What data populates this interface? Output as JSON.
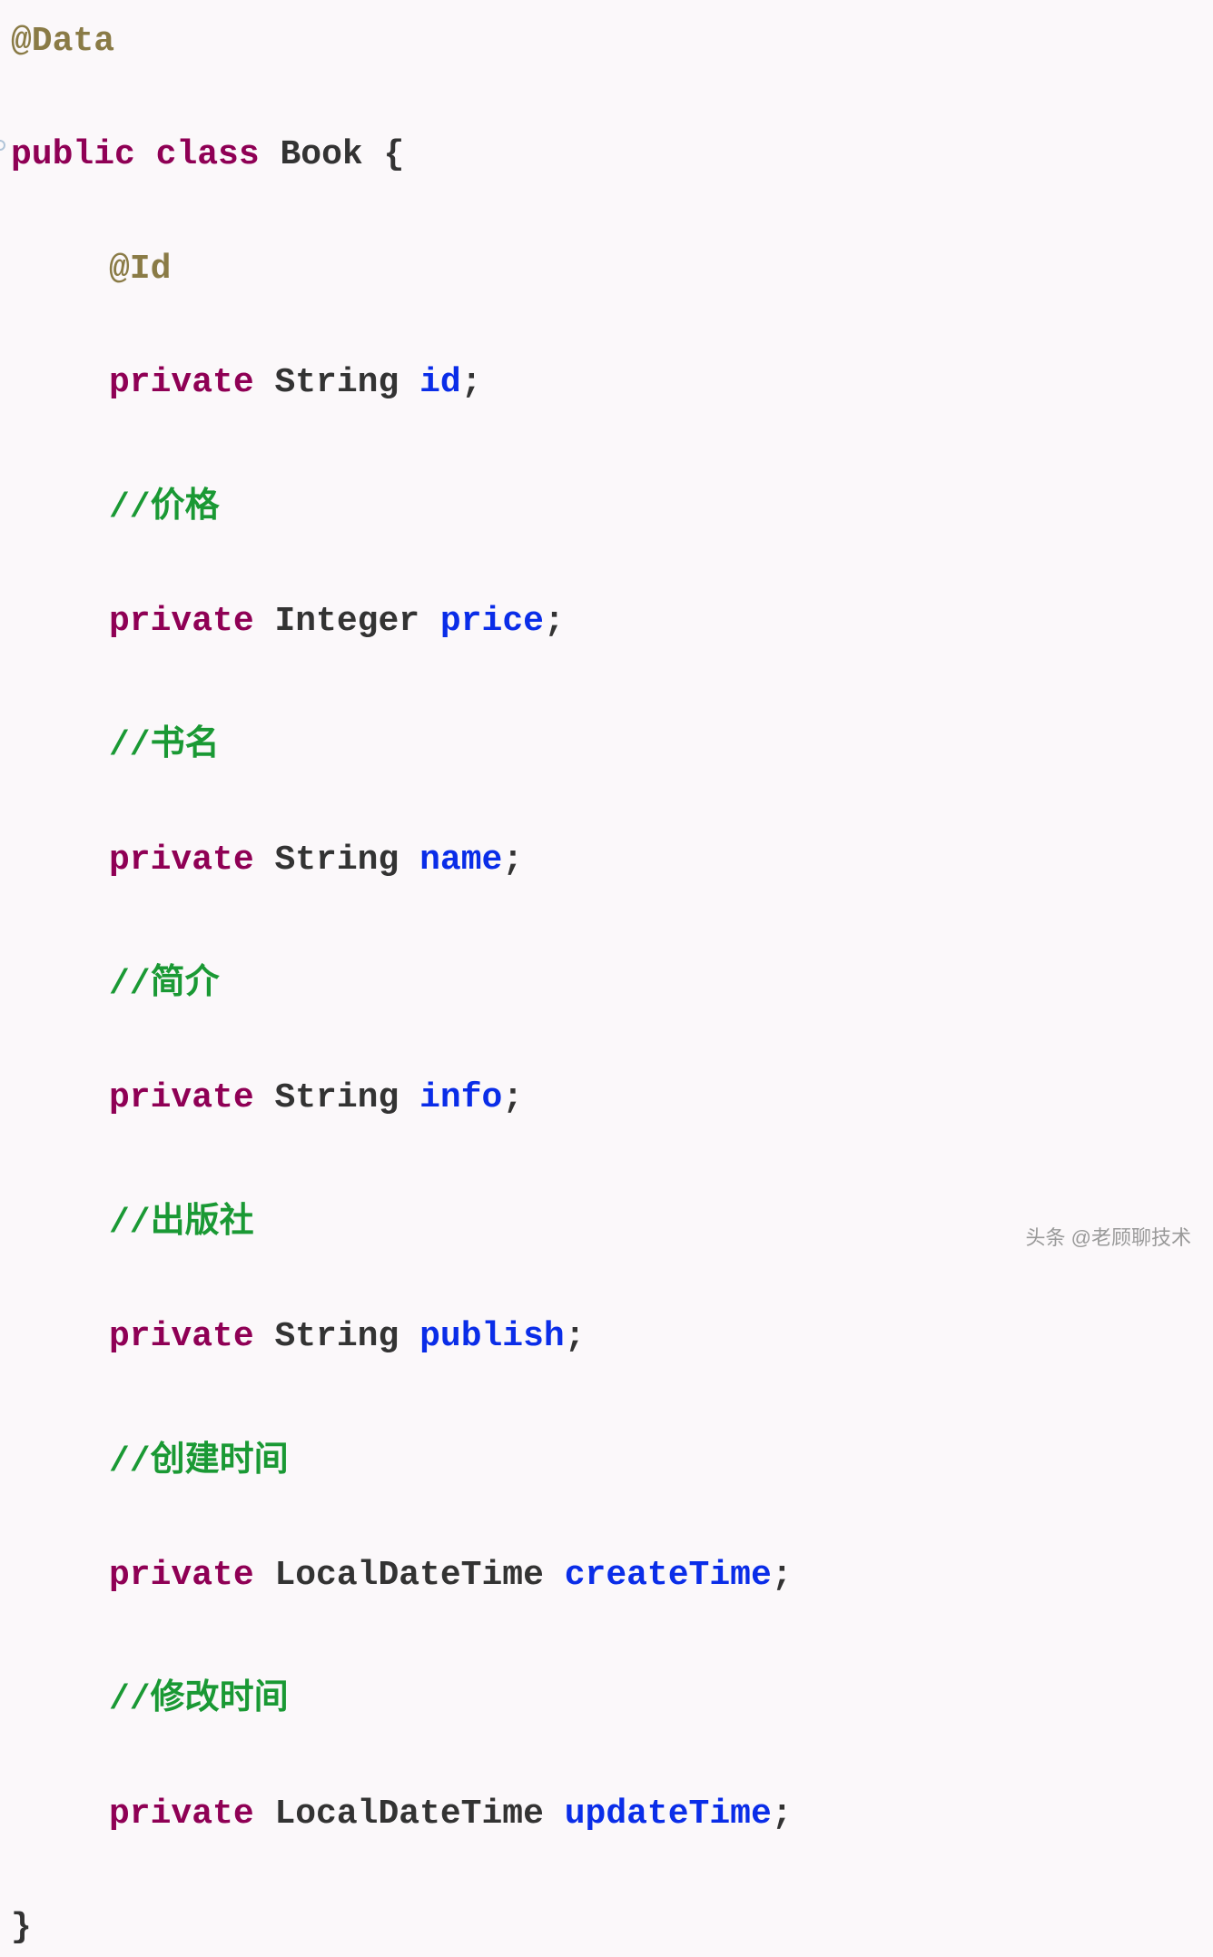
{
  "code": {
    "line1_annotation": "@Data",
    "line2_kw1": "public",
    "line2_kw2": "class",
    "line2_name": "Book",
    "line2_brace": " {",
    "line3_annotation": "@Id",
    "line4_kw": "private",
    "line4_type": "String",
    "line4_id": "id",
    "line4_semi": ";",
    "line5_comment": "//价格",
    "line6_kw": "private",
    "line6_type": "Integer",
    "line6_id": "price",
    "line6_semi": ";",
    "line7_comment": "//书名",
    "line8_kw": "private",
    "line8_type": "String",
    "line8_id": "name",
    "line8_semi": ";",
    "line9_comment": "//简介",
    "line10_kw": "private",
    "line10_type": "String",
    "line10_id": "info",
    "line10_semi": ";",
    "line11_comment": "//出版社",
    "line12_kw": "private",
    "line12_type": "String",
    "line12_id": "publish",
    "line12_semi": ";",
    "line13_comment": "//创建时间",
    "line14_kw": "private",
    "line14_type": "LocalDateTime",
    "line14_id": "createTime",
    "line14_semi": ";",
    "line15_comment": "//修改时间",
    "line16_kw": "private",
    "line16_type": "LocalDateTime",
    "line16_id": "updateTime",
    "line16_semi": ";",
    "line17_brace": "}"
  },
  "watermark": "头条 @老顾聊技术"
}
